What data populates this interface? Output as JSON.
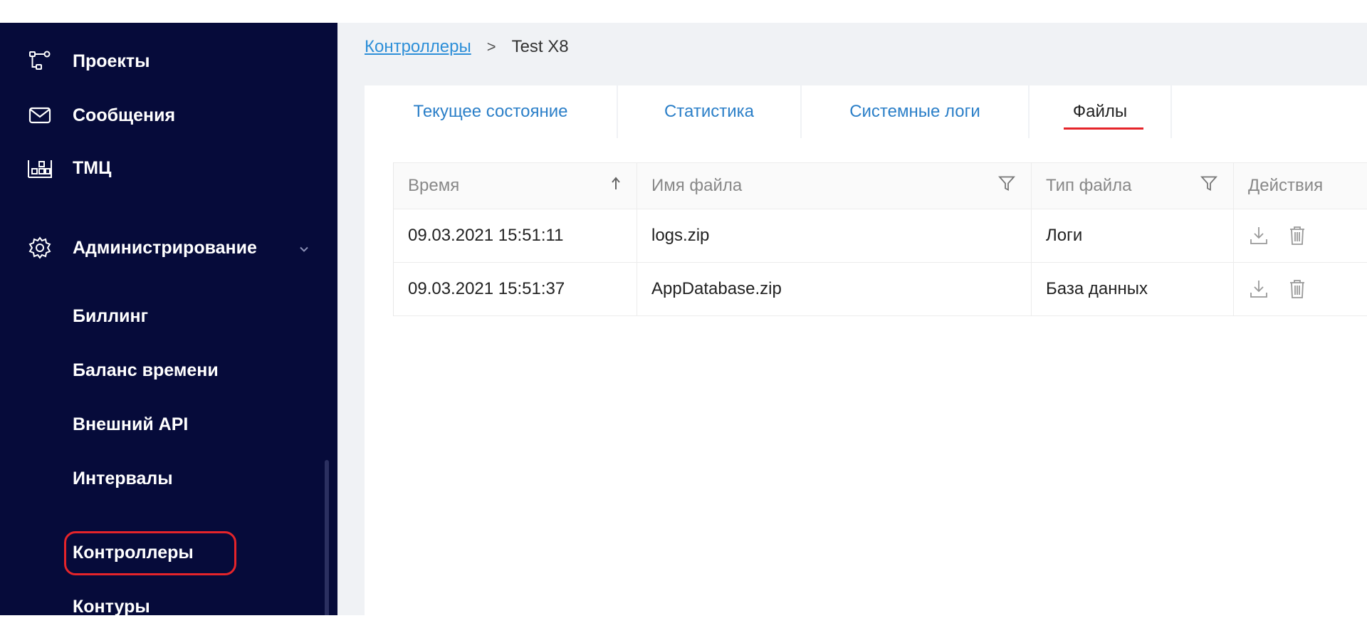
{
  "sidebar": {
    "items": [
      {
        "label": "Проекты",
        "icon": "projects-icon"
      },
      {
        "label": "Сообщения",
        "icon": "mail-icon"
      },
      {
        "label": "ТМЦ",
        "icon": "warehouse-icon"
      },
      {
        "label": "Администрирование",
        "icon": "gear-icon"
      }
    ],
    "sub_items": [
      {
        "label": "Биллинг"
      },
      {
        "label": "Баланс времени"
      },
      {
        "label": "Внешний API"
      },
      {
        "label": "Интервалы"
      },
      {
        "label": "Контроллеры"
      },
      {
        "label": "Контуры"
      }
    ]
  },
  "breadcrumb": {
    "parent": "Контроллеры",
    "separator": ">",
    "current": "Test X8"
  },
  "tabs": [
    {
      "label": "Текущее состояние"
    },
    {
      "label": "Статистика"
    },
    {
      "label": "Системные логи"
    },
    {
      "label": "Файлы",
      "active": true
    }
  ],
  "table": {
    "columns": [
      "Время",
      "Имя файла",
      "Тип файла",
      "Действия"
    ],
    "rows": [
      {
        "time": "09.03.2021 15:51:11",
        "name": "logs.zip",
        "type": "Логи"
      },
      {
        "time": "09.03.2021 15:51:37",
        "name": "AppDatabase.zip",
        "type": "База данных"
      }
    ]
  },
  "colors": {
    "sidebar_bg": "#060b3a",
    "accent": "#2b7fc8",
    "highlight": "#e5242a"
  }
}
